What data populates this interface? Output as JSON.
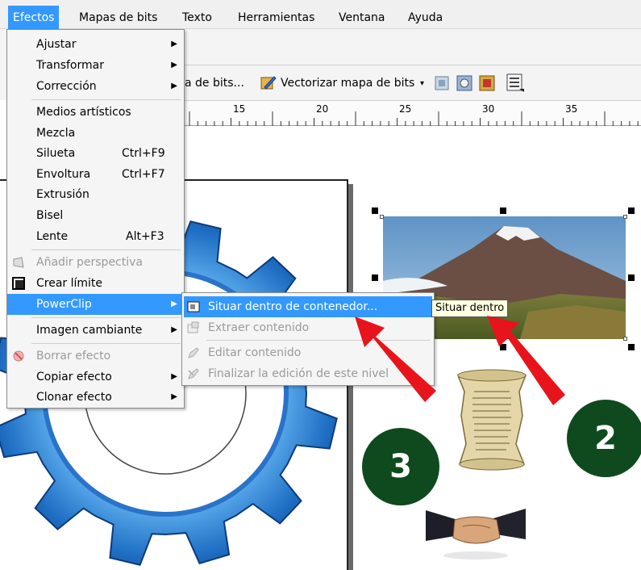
{
  "menubar": {
    "items": [
      "Efectos",
      "Mapas de bits",
      "Texto",
      "Herramientas",
      "Ventana",
      "Ayuda"
    ]
  },
  "toolbar": {
    "bitmap_partial": "a de bits...",
    "vectorize": "Vectorizar mapa de bits"
  },
  "ruler": {
    "ticks": [
      "15",
      "20",
      "25",
      "30",
      "35"
    ]
  },
  "effects_menu": {
    "items": [
      {
        "label": "Ajustar",
        "shortcut": "",
        "submenu": true,
        "disabled": false
      },
      {
        "label": "Transformar",
        "shortcut": "",
        "submenu": true,
        "disabled": false
      },
      {
        "label": "Corrección",
        "shortcut": "",
        "submenu": true,
        "disabled": false
      },
      {
        "label": "Medios artísticos",
        "shortcut": "",
        "submenu": false,
        "disabled": false
      },
      {
        "label": "Mezcla",
        "shortcut": "",
        "submenu": false,
        "disabled": false
      },
      {
        "label": "Silueta",
        "shortcut": "Ctrl+F9",
        "submenu": false,
        "disabled": false
      },
      {
        "label": "Envoltura",
        "shortcut": "Ctrl+F7",
        "submenu": false,
        "disabled": false
      },
      {
        "label": "Extrusión",
        "shortcut": "",
        "submenu": false,
        "disabled": false
      },
      {
        "label": "Bisel",
        "shortcut": "",
        "submenu": false,
        "disabled": false
      },
      {
        "label": "Lente",
        "shortcut": "Alt+F3",
        "submenu": false,
        "disabled": false
      },
      {
        "label": "Añadir perspectiva",
        "shortcut": "",
        "submenu": false,
        "disabled": true
      },
      {
        "label": "Crear límite",
        "shortcut": "",
        "submenu": false,
        "disabled": false
      },
      {
        "label": "PowerClip",
        "shortcut": "",
        "submenu": true,
        "disabled": false
      },
      {
        "label": "Imagen cambiante",
        "shortcut": "",
        "submenu": true,
        "disabled": false
      },
      {
        "label": "Borrar efecto",
        "shortcut": "",
        "submenu": false,
        "disabled": true
      },
      {
        "label": "Copiar efecto",
        "shortcut": "",
        "submenu": true,
        "disabled": false
      },
      {
        "label": "Clonar efecto",
        "shortcut": "",
        "submenu": true,
        "disabled": false
      }
    ]
  },
  "powerclip_menu": {
    "items": [
      {
        "label": "Situar dentro de contenedor...",
        "disabled": false
      },
      {
        "label": "Extraer contenido",
        "disabled": true
      },
      {
        "label": "Editar contenido",
        "disabled": true
      },
      {
        "label": "Finalizar la edición de este nivel",
        "disabled": true
      }
    ]
  },
  "tooltip": "Situar dentro",
  "callouts": [
    "3",
    "2"
  ],
  "colors": {
    "accent": "#3399ff",
    "callout_green": "#0f4a1f",
    "arrow_red": "#e8141b",
    "gear_blue": "#1f6fc4"
  }
}
